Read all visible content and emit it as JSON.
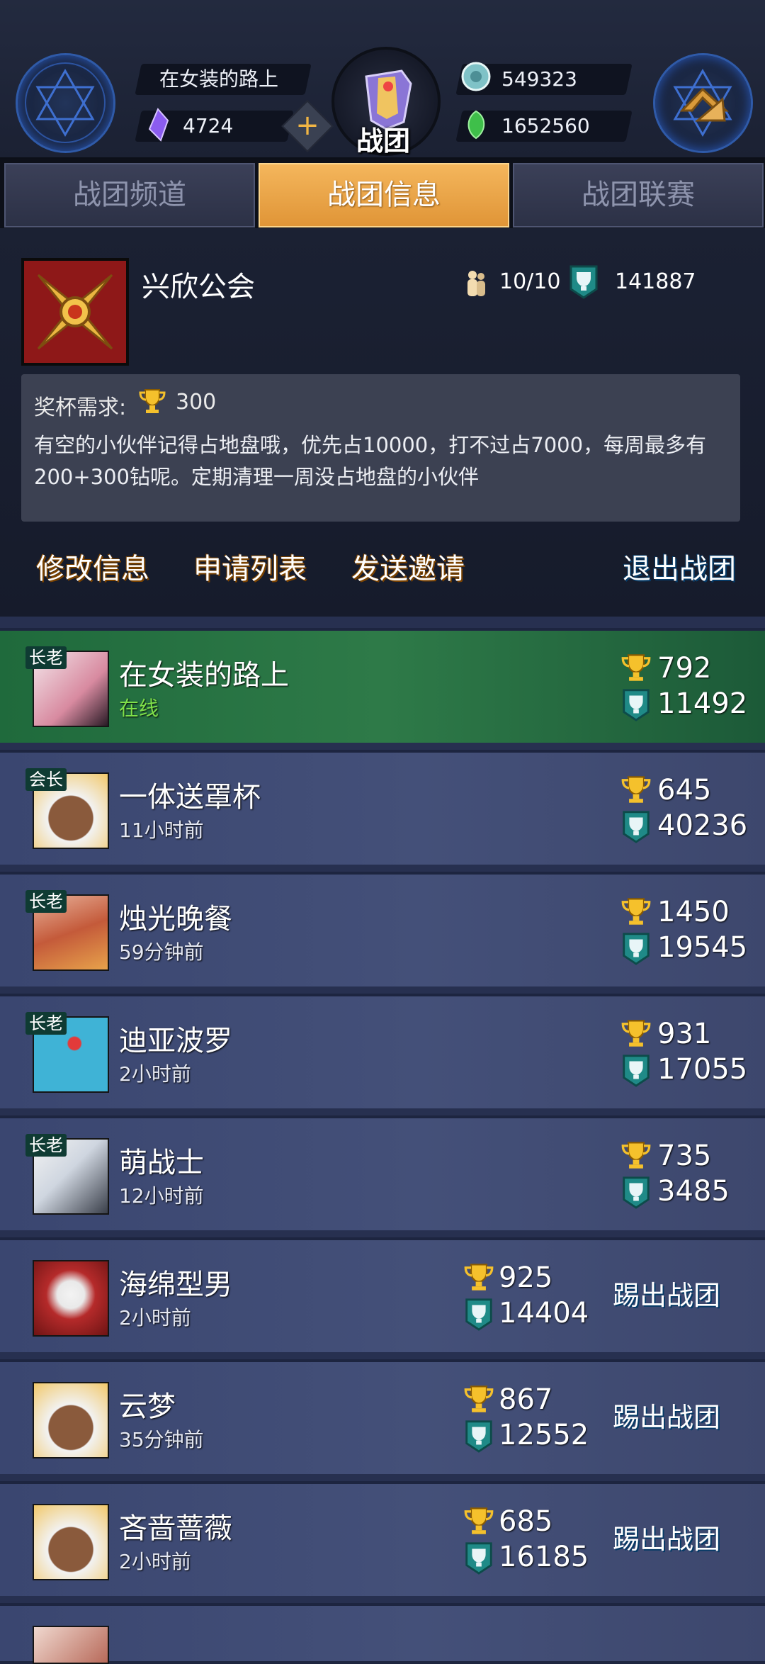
{
  "header": {
    "player_name": "在女装的路上",
    "gems": "4724",
    "emblem_label": "战团",
    "currency_a": "549323",
    "currency_b": "1652560"
  },
  "tabs": [
    {
      "label": "战团频道",
      "active": false
    },
    {
      "label": "战团信息",
      "active": true
    },
    {
      "label": "战团联赛",
      "active": false
    }
  ],
  "guild": {
    "name": "兴欣公会",
    "members": "10/10",
    "trophies": "141887",
    "req_label": "奖杯需求:",
    "req_value": "300",
    "description": "有空的小伙伴记得占地盘哦，优先占10000，打不过占7000，每周最多有200+300钻呢。定期清理一周没占地盘的小伙伴"
  },
  "actions": {
    "edit": "修改信息",
    "requests": "申请列表",
    "invite": "发送邀请",
    "leave": "退出战团"
  },
  "member_list": [
    {
      "role": "长老",
      "name": "在女装的路上",
      "status": "在线",
      "online": true,
      "trophy": "792",
      "cup": "11492",
      "kick": ""
    },
    {
      "role": "会长",
      "name": "一体送罩杯",
      "status": "11小时前",
      "online": false,
      "trophy": "645",
      "cup": "40236",
      "kick": ""
    },
    {
      "role": "长老",
      "name": "烛光晚餐",
      "status": "59分钟前",
      "online": false,
      "trophy": "1450",
      "cup": "19545",
      "kick": ""
    },
    {
      "role": "长老",
      "name": "迪亚波罗",
      "status": "2小时前",
      "online": false,
      "trophy": "931",
      "cup": "17055",
      "kick": ""
    },
    {
      "role": "长老",
      "name": "萌战士",
      "status": "12小时前",
      "online": false,
      "trophy": "735",
      "cup": "3485",
      "kick": ""
    },
    {
      "role": "",
      "name": "海绵型男",
      "status": "2小时前",
      "online": false,
      "trophy": "925",
      "cup": "14404",
      "kick": "踢出战团"
    },
    {
      "role": "",
      "name": "云梦",
      "status": "35分钟前",
      "online": false,
      "trophy": "867",
      "cup": "12552",
      "kick": "踢出战团"
    },
    {
      "role": "",
      "name": "吝啬蔷薇",
      "status": "2小时前",
      "online": false,
      "trophy": "685",
      "cup": "16185",
      "kick": "踢出战团"
    }
  ],
  "colors": {
    "accent_gold": "#f3a419",
    "accent_blue": "#1e8fe0",
    "online_green": "#7fe04a"
  }
}
